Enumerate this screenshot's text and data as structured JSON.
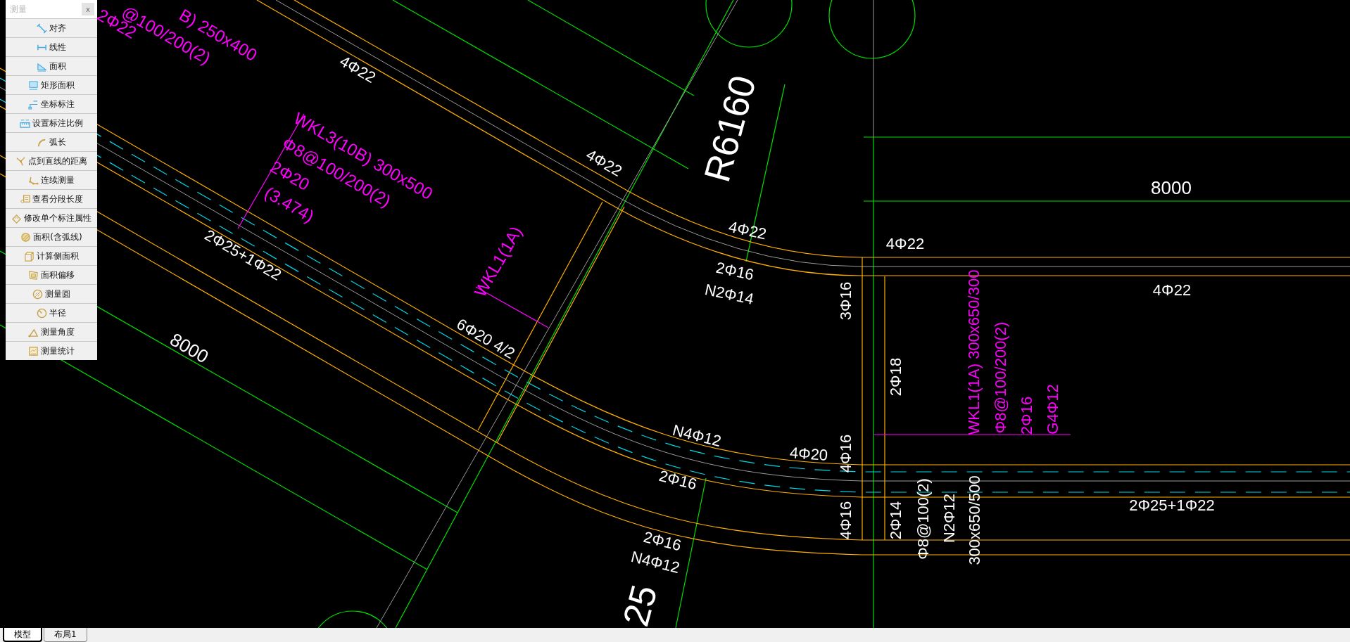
{
  "panel": {
    "title": "测量",
    "close": "x",
    "tools": [
      {
        "label": "对齐"
      },
      {
        "label": "线性"
      },
      {
        "label": "面积"
      },
      {
        "label": "矩形面积"
      },
      {
        "label": "坐标标注"
      },
      {
        "label": "设置标注比例"
      },
      {
        "label": "弧长"
      },
      {
        "label": "点到直线的距离"
      },
      {
        "label": "连续测量"
      },
      {
        "label": "查看分段长度"
      },
      {
        "label": "修改单个标注属性"
      },
      {
        "label": "面积(含弧线)"
      },
      {
        "label": "计算侧面积"
      },
      {
        "label": "面积偏移"
      },
      {
        "label": "测量圆"
      },
      {
        "label": "半径"
      },
      {
        "label": "测量角度"
      },
      {
        "label": "测量统计"
      }
    ]
  },
  "drawing": {
    "annotations": [
      {
        "text": "B) 250x400",
        "color": "#ff00ff"
      },
      {
        "text": "@100/200(2)",
        "color": "#ff00ff"
      },
      {
        "text": "2Φ22",
        "color": "#ff00ff"
      },
      {
        "text": "4Φ22",
        "color": "#ffffff"
      },
      {
        "text": "WKL3(10B) 300x500",
        "color": "#ff00ff"
      },
      {
        "text": "Φ8@100/200(2)",
        "color": "#ff00ff"
      },
      {
        "text": "2Φ20",
        "color": "#ff00ff"
      },
      {
        "text": "(3.474)",
        "color": "#ff00ff"
      },
      {
        "text": "2Φ25+1Φ22",
        "color": "#ffffff"
      },
      {
        "text": "8000",
        "color": "#ffffff"
      },
      {
        "text": "4Φ22",
        "color": "#ffffff"
      },
      {
        "text": "R6160",
        "color": "#ffffff"
      },
      {
        "text": "WKL1(1A)",
        "color": "#ff00ff"
      },
      {
        "text": "4Φ22",
        "color": "#ffffff"
      },
      {
        "text": "2Φ16",
        "color": "#ffffff"
      },
      {
        "text": "N2Φ14",
        "color": "#ffffff"
      },
      {
        "text": "3Φ16",
        "color": "#ffffff"
      },
      {
        "text": "4Φ22",
        "color": "#ffffff"
      },
      {
        "text": "8000",
        "color": "#ffffff"
      },
      {
        "text": "4Φ22",
        "color": "#ffffff"
      },
      {
        "text": "6Φ20 4/2",
        "color": "#ffffff"
      },
      {
        "text": "N4Φ12",
        "color": "#ffffff"
      },
      {
        "text": "4Φ20",
        "color": "#ffffff"
      },
      {
        "text": "2Φ16",
        "color": "#ffffff"
      },
      {
        "text": "2Φ16",
        "color": "#ffffff"
      },
      {
        "text": "N4Φ12",
        "color": "#ffffff"
      },
      {
        "text": "25",
        "color": "#ffffff"
      },
      {
        "text": "4Φ16",
        "color": "#ffffff"
      },
      {
        "text": "4Φ16",
        "color": "#ffffff"
      },
      {
        "text": "2Φ18",
        "color": "#ffffff"
      },
      {
        "text": "2Φ14",
        "color": "#ffffff"
      },
      {
        "text": "Φ8@100(2)",
        "color": "#ffffff"
      },
      {
        "text": "N2Φ12",
        "color": "#ffffff"
      },
      {
        "text": "300x650/500",
        "color": "#ffffff"
      },
      {
        "text": "WKL1(1A) 300x650/300",
        "color": "#ff00ff"
      },
      {
        "text": "Φ8@100/200(2)",
        "color": "#ff00ff"
      },
      {
        "text": "2Φ16",
        "color": "#ff00ff"
      },
      {
        "text": "G4Φ12",
        "color": "#ff00ff"
      },
      {
        "text": "2Φ25+1Φ22",
        "color": "#ffffff"
      }
    ]
  },
  "layout_tabs": [
    {
      "label": "模型",
      "selected": true
    },
    {
      "label": "布局1",
      "selected": false
    }
  ]
}
